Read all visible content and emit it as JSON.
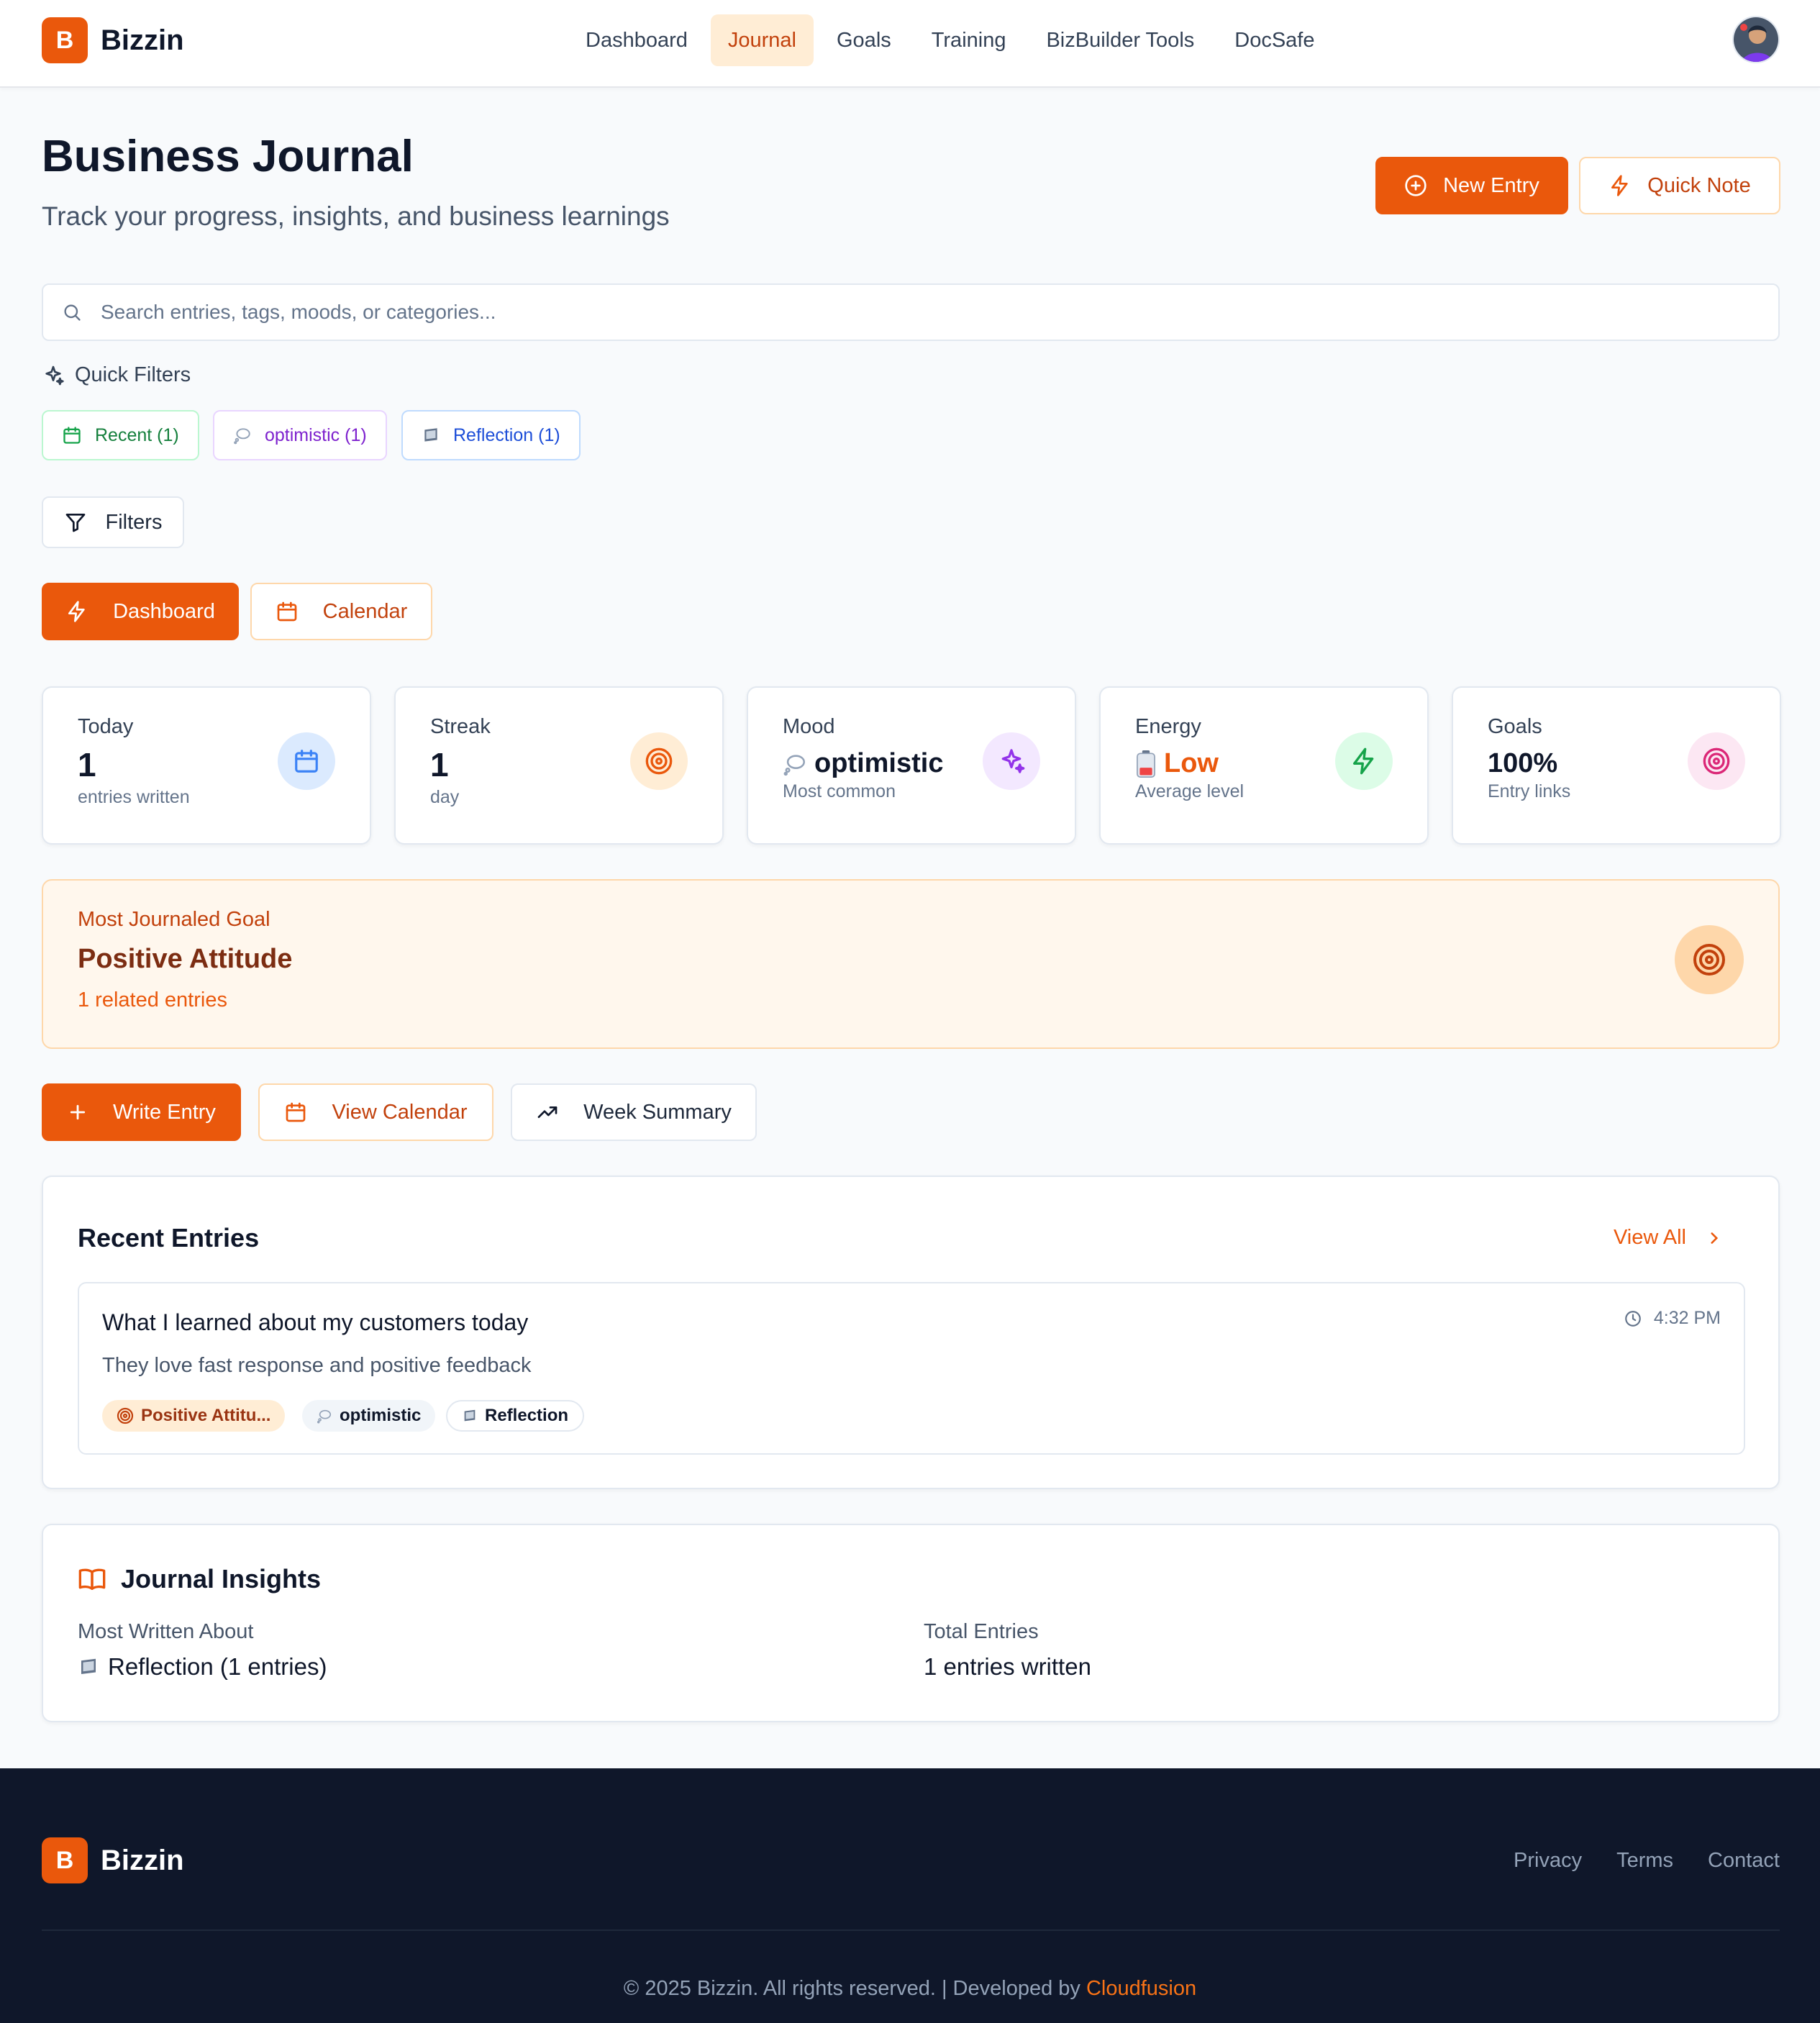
{
  "app": {
    "name": "Bizzin",
    "logo_letter": "B"
  },
  "nav": {
    "items": [
      {
        "label": "Dashboard",
        "active": false
      },
      {
        "label": "Journal",
        "active": true
      },
      {
        "label": "Goals",
        "active": false
      },
      {
        "label": "Training",
        "active": false
      },
      {
        "label": "BizBuilder Tools",
        "active": false
      },
      {
        "label": "DocSafe",
        "active": false
      }
    ]
  },
  "header": {
    "title": "Business Journal",
    "subtitle": "Track your progress, insights, and business learnings",
    "new_entry_label": "New Entry",
    "quick_note_label": "Quick Note"
  },
  "search": {
    "placeholder": "Search entries, tags, moods, or categories...",
    "value": ""
  },
  "quick_filters": {
    "label": "Quick Filters",
    "chips": [
      {
        "label": "Recent (1)",
        "icon": "calendar-icon"
      },
      {
        "label": "optimistic (1)",
        "icon": "thought-bubble-icon"
      },
      {
        "label": "Reflection (1)",
        "icon": "notebook-icon"
      }
    ]
  },
  "filters_label": "Filters",
  "view_toggle": {
    "dashboard_label": "Dashboard",
    "calendar_label": "Calendar",
    "active": "Dashboard"
  },
  "stats": {
    "today": {
      "label": "Today",
      "value": "1",
      "sub": "entries written",
      "icon": "calendar-icon",
      "color": "#3b82f6"
    },
    "streak": {
      "label": "Streak",
      "value": "1",
      "sub": "day",
      "icon": "target-icon",
      "color": "#ea580c"
    },
    "mood": {
      "label": "Mood",
      "value": "optimistic",
      "sub": "Most common",
      "icon": "sparkles-icon",
      "color": "#9333ea"
    },
    "energy": {
      "label": "Energy",
      "value": "Low",
      "sub": "Average level",
      "icon": "lightning-icon",
      "color": "#16a34a",
      "value_color": "#ea580c"
    },
    "goals": {
      "label": "Goals",
      "value": "100%",
      "sub": "Entry links",
      "icon": "target-icon",
      "color": "#db2777"
    }
  },
  "goal_banner": {
    "label": "Most Journaled Goal",
    "title": "Positive Attitude",
    "sub": "1 related entries"
  },
  "actions": {
    "write_entry": "Write Entry",
    "view_calendar": "View Calendar",
    "week_summary": "Week Summary"
  },
  "recent": {
    "title": "Recent Entries",
    "view_all": "View All",
    "entries": [
      {
        "title": "What I learned about my customers today",
        "body": "They love fast response and positive feedback",
        "time": "4:32 PM",
        "tags": {
          "goal": "Positive Attitu...",
          "mood": "optimistic",
          "category": "Reflection"
        }
      }
    ]
  },
  "insights": {
    "title": "Journal Insights",
    "most_written_label": "Most Written About",
    "most_written_value": "Reflection (1 entries)",
    "total_label": "Total Entries",
    "total_value": "1 entries written"
  },
  "footer": {
    "links": [
      "Privacy",
      "Terms",
      "Contact"
    ],
    "copyright": "© 2025 Bizzin. All rights reserved. | Developed by",
    "developer": "Cloudfusion"
  },
  "colors": {
    "accent": "#ea580c",
    "footer_bg": "#0f172a"
  }
}
